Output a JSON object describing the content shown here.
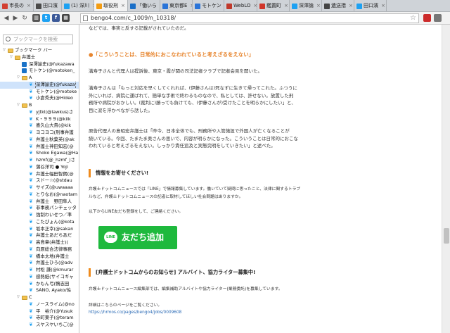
{
  "tabs": [
    {
      "label": "市長の",
      "color": "#d23f31"
    },
    {
      "label": "田口濱",
      "color": "#4a4a4a"
    },
    {
      "label": "(1) 深川",
      "color": "#1da1f2"
    },
    {
      "label": "取役刑",
      "color": "#f39c12",
      "active": true
    },
    {
      "label": "「働いら",
      "color": "#1a6fc8"
    },
    {
      "label": "東京都E",
      "color": "#2a74d8"
    },
    {
      "label": "モトケン",
      "color": "#2a74d8"
    },
    {
      "label": "WebLO",
      "color": "#c0392b"
    },
    {
      "label": "鑑置町",
      "color": "#d0352a"
    },
    {
      "label": "深澤論",
      "color": "#1da1f2"
    },
    {
      "label": "遺送措",
      "color": "#444"
    },
    {
      "label": "田口濱",
      "color": "#1da1f2"
    }
  ],
  "url": "bengo4.com/c_1009/n_10318/",
  "sidebar": {
    "search_placeholder": "ブックマークを検索",
    "items": [
      {
        "label": "ブックマーク バー",
        "type": "folder",
        "indent": 0,
        "tw": "▽"
      },
      {
        "label": "弁護士",
        "type": "folder",
        "indent": 1,
        "tw": "▽"
      },
      {
        "label": "深澤諭史(@fukazawa",
        "type": "box",
        "indent": 2
      },
      {
        "label": "モトケン(@motoken_",
        "type": "box",
        "indent": 2
      },
      {
        "label": "A",
        "type": "folder",
        "indent": 2,
        "tw": "▽"
      },
      {
        "label": "深澤諭史(@fukaza",
        "type": "bird",
        "indent": 3,
        "selected": true
      },
      {
        "label": "モトケン(@motoke",
        "type": "bird",
        "indent": 3
      },
      {
        "label": "小倉秀夫(@Hideo",
        "type": "bird",
        "indent": 3
      },
      {
        "label": "B",
        "type": "folder",
        "indent": 2,
        "tw": "▽"
      },
      {
        "label": "yjtkl(@lawkus)さ",
        "type": "bird",
        "indent": 3
      },
      {
        "label": "K・９９９(@kilk",
        "type": "bird",
        "indent": 3
      },
      {
        "label": "喜久山大貴(@kik",
        "type": "bird",
        "indent": 3
      },
      {
        "label": "ヨコヨコ(刑事弁護",
        "type": "bird",
        "indent": 3
      },
      {
        "label": "弁護士秋葉英(@ak",
        "type": "bird",
        "indent": 3
      },
      {
        "label": "弁護士神田知宏(@",
        "type": "bird",
        "indent": 3
      },
      {
        "label": "Shoko Egawa(@Ha",
        "type": "bird",
        "indent": 3
      },
      {
        "label": "hzmf(@_hzmf_)さ",
        "type": "bird",
        "indent": 3
      },
      {
        "label": "蒲谷洋司 ● Yoji ",
        "type": "bird",
        "indent": 3
      },
      {
        "label": "弁護士幅田智朗(@",
        "type": "bird",
        "indent": 3
      },
      {
        "label": "スドー☆(@stdau",
        "type": "bird",
        "indent": 3
      },
      {
        "label": "サイズ(@uwaaaa",
        "type": "bird",
        "indent": 3
      },
      {
        "label": "とりなお(@naotam",
        "type": "bird",
        "indent": 3
      },
      {
        "label": "弁護士　野田隼人",
        "type": "bird",
        "indent": 3
      },
      {
        "label": "非事務パンチェッタ",
        "type": "bird",
        "indent": 3
      },
      {
        "label": "強制わいせつ／準",
        "type": "bird",
        "indent": 3
      },
      {
        "label": "こたぴょん(@kota",
        "type": "bird",
        "indent": 3
      },
      {
        "label": "坂本正幸(@sakan",
        "type": "bird",
        "indent": 3
      },
      {
        "label": "弁護士あだちあだ",
        "type": "bird",
        "indent": 3
      },
      {
        "label": "高島章(弁護士)(",
        "type": "bird",
        "indent": 3
      },
      {
        "label": "向原総合法律事務",
        "type": "bird",
        "indent": 3
      },
      {
        "label": "橋本太地(弁護士",
        "type": "bird",
        "indent": 3
      },
      {
        "label": "弁護士ひろ(@adv",
        "type": "bird",
        "indent": 3
      },
      {
        "label": "村松 謙(@kmurar",
        "type": "bird",
        "indent": 3
      },
      {
        "label": "感熱紙(サイコギャ",
        "type": "bird",
        "indent": 3
      },
      {
        "label": "かもん弓(鴨志田",
        "type": "bird",
        "indent": 3
      },
      {
        "label": "SANO, Ayako/佐",
        "type": "bird",
        "indent": 3
      },
      {
        "label": "C",
        "type": "folder",
        "indent": 2,
        "tw": "▽"
      },
      {
        "label": "ノースライム(@no",
        "type": "bird",
        "indent": 3
      },
      {
        "label": "平　裕介(@Yusuk",
        "type": "bird",
        "indent": 3
      },
      {
        "label": "寺町東子(@teram",
        "type": "bird",
        "indent": 3
      },
      {
        "label": "スヤスヤいちご(@",
        "type": "bird",
        "indent": 3
      }
    ]
  },
  "article": {
    "p0": "などでは、事実と反する記載がされていたのだ。",
    "subhead": "●「こういうことは、日常的におこなわれていると考えざるをえない」",
    "p1": "滿寿子さんと代理人は提訴後、東京・霞が関の司法記者クラブで記者会見を開いた。",
    "p2a": "滿寿子さんは「もっと対応を早くしてくれれば、(伊藤さんは)死なずに生きて帰ってこれた。ふつうに",
    "p2b": "外にいれば、病院に運ばれて、簡単な手術で終わるものなので、私としては、許せない。放置した刑",
    "p2c": "務所や病院がおかしい。(裁判に)勝っても負けても、(伊藤さんが)受けたことを明らかにしたい」と、",
    "p2d": "目に涙を浮かべながら話した。",
    "p3a": "原告代理人の島昭宏弁護士は「昨今、日本全体でも、刑務所や入管施設で外国人が亡くなることが",
    "p3b": "続いている。今回、たまたま奥さんの思いで、内容が明らかになった。こういうことは日常的におこな",
    "p3c": "われていると考えざるをえない。しっかり責任追及と実態究明をしていきたい」と述べた。",
    "info_heading": "情報をお寄せください!",
    "info_p1a": "弁護士ドットコムニュースでは「LINE」で情報募集しています。働いていて疑問に思ったこと、法律に関するトラブ",
    "info_p1b": "ルなど、弁護士ドットコムニュースの記者に取材してほしい社会問題はありますか。",
    "info_p2": "以下からLINE友だち登録をして、ご連絡ください。",
    "line_bubble": "LINE",
    "line_button": "友だち追加",
    "writer_heading": "[弁護士ドットコムからのお知らせ] アルバイト、協力ライター募集中!",
    "writer_p1": "弁護士ドットコムニュース編集部では、編集補助アルバイトや協力ライター(業務委託)を募集しています。",
    "writer_p2": "詳細はこちらのページをご覧ください。",
    "writer_link": "https://hrmos.co/pages/bengo4/jobs/0009608"
  }
}
